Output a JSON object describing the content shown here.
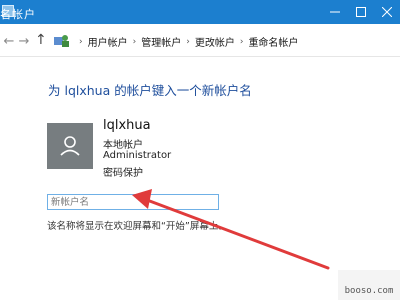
{
  "window": {
    "title": "名帐户",
    "controls": [
      "minimize-icon",
      "maximize-icon",
      "close-icon"
    ]
  },
  "navbar": {
    "back_glyph": "←",
    "forward_glyph": "→",
    "up_glyph": "↑",
    "breadcrumbs": [
      "用户帐户",
      "管理帐户",
      "更改帐户",
      "重命名帐户"
    ],
    "separator": "›"
  },
  "main": {
    "heading": "为 lqlxhua 的帐户键入一个新帐户名",
    "account": {
      "name": "lqlxhua",
      "type": "本地帐户",
      "role": "Administrator",
      "protection": "密码保护"
    },
    "new_name_input": {
      "value": "",
      "placeholder": "新帐户名"
    },
    "hint": "该名称将显示在欢迎屏幕和“开始”屏幕上。"
  },
  "watermark": {
    "text": "booso.com"
  },
  "colors": {
    "titlebar": "#1c7fcf",
    "heading": "#1e4e9c",
    "input_border": "#6fb0e6",
    "arrow": "#e03b3b"
  }
}
